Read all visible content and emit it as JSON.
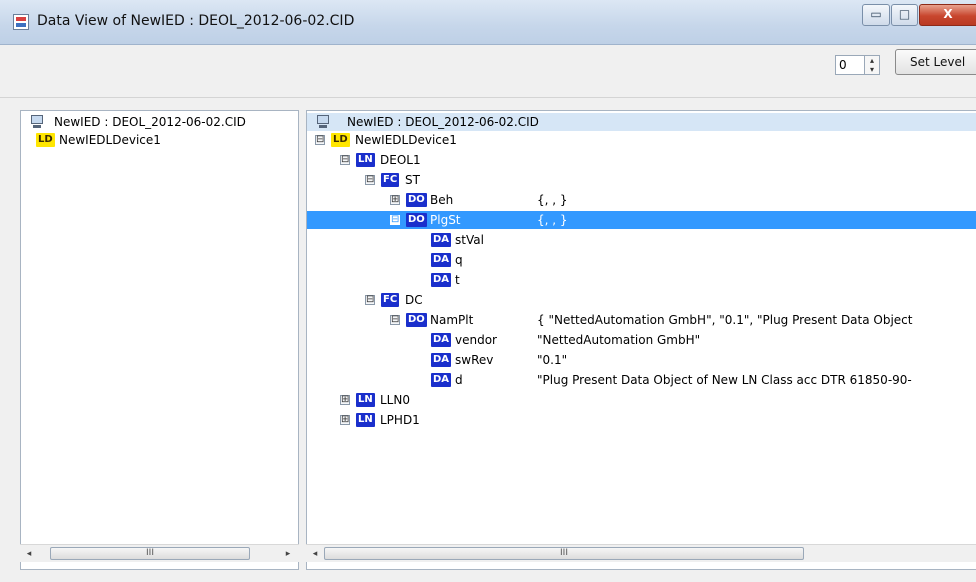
{
  "window": {
    "title": "Data View of NewIED : DEOL_2012-06-02.CID",
    "minimize_glyph": "▭",
    "maximize_glyph": "□",
    "close_glyph": "X"
  },
  "toolbar": {
    "level_value": "0",
    "set_level_label": "Set Level"
  },
  "left_tree": {
    "root": "NewIED : DEOL_2012-06-02.CID",
    "items": [
      {
        "badge": "LD",
        "label": "NewIEDLDevice1"
      }
    ]
  },
  "right_tree": {
    "root": "NewIED : DEOL_2012-06-02.CID",
    "rows": [
      {
        "badge": "LD",
        "label": "NewIEDLDevice1",
        "expander": "⊟",
        "value": ""
      },
      {
        "badge": "LN",
        "label": "DEOL1",
        "expander": "⊟",
        "value": ""
      },
      {
        "badge": "FC",
        "label": "ST",
        "expander": "⊟",
        "value": ""
      },
      {
        "badge": "DO",
        "label": "Beh",
        "expander": "⊞",
        "value": "{, , }"
      },
      {
        "badge": "DO",
        "label": "PlgSt",
        "expander": "⊟",
        "value": "{, , }"
      },
      {
        "badge": "DA",
        "label": "stVal",
        "expander": "",
        "value": ""
      },
      {
        "badge": "DA",
        "label": "q",
        "expander": "",
        "value": ""
      },
      {
        "badge": "DA",
        "label": "t",
        "expander": "",
        "value": ""
      },
      {
        "badge": "FC",
        "label": "DC",
        "expander": "⊟",
        "value": ""
      },
      {
        "badge": "DO",
        "label": "NamPlt",
        "expander": "⊟",
        "value": "{ \"NettedAutomation GmbH\", \"0.1\", \"Plug Present Data Object"
      },
      {
        "badge": "DA",
        "label": "vendor",
        "expander": "",
        "value": "\"NettedAutomation GmbH\""
      },
      {
        "badge": "DA",
        "label": "swRev",
        "expander": "",
        "value": "\"0.1\""
      },
      {
        "badge": "DA",
        "label": "d",
        "expander": "",
        "value": "\"Plug Present Data Object of New LN Class acc DTR 61850-90-"
      },
      {
        "badge": "LN",
        "label": "LLN0",
        "expander": "⊞",
        "value": ""
      },
      {
        "badge": "LN",
        "label": "LPHD1",
        "expander": "⊞",
        "value": ""
      }
    ],
    "selected_row": "PlgSt"
  },
  "scrollbars": {
    "left_arrow": "◂",
    "right_arrow": "▸",
    "grip": "III"
  },
  "icons": {
    "app": "data-view-app-icon",
    "computer": "computer-icon",
    "spin": "spinner-arrows-icon"
  },
  "colors": {
    "selection": "#3399ff",
    "ld_badge": "#ffe600",
    "node_badge": "#1a2fcc",
    "header_row": "#d6e6f6"
  }
}
